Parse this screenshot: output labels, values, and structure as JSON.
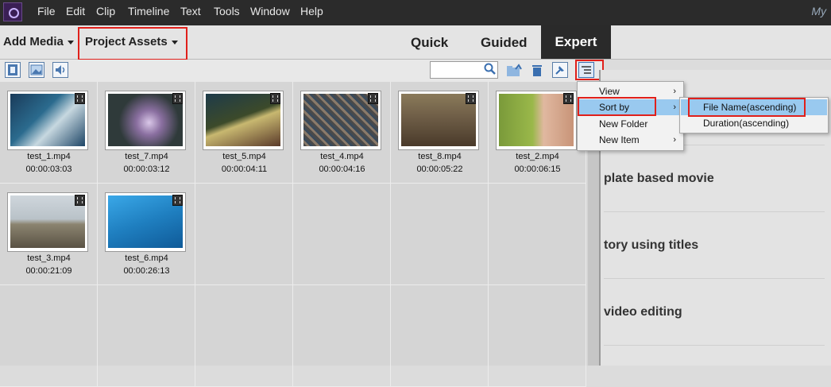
{
  "menu": {
    "items": [
      "File",
      "Edit",
      "Clip",
      "Timeline",
      "Text",
      "Tools",
      "Window",
      "Help"
    ],
    "right_text": "My"
  },
  "modebar": {
    "add_media": "Add Media",
    "project_assets": "Project Assets",
    "tab_quick": "Quick",
    "tab_guided": "Guided",
    "tab_expert": "Expert"
  },
  "toolbar": {
    "view_icons": [
      "film-icon",
      "image-icon",
      "speaker-icon"
    ],
    "search_value": "",
    "right_icons": [
      "search-icon",
      "folder-up-icon",
      "trash-icon",
      "pin-icon",
      "list-menu-icon"
    ]
  },
  "assets": [
    {
      "name": "test_1.mp4",
      "duration": "00:00:03:03",
      "color": "#2b6b8e"
    },
    {
      "name": "test_7.mp4",
      "duration": "00:00:03:12",
      "color": "#6a5a78"
    },
    {
      "name": "test_5.mp4",
      "duration": "00:00:04:11",
      "color": "#3c4a2a"
    },
    {
      "name": "test_4.mp4",
      "duration": "00:00:04:16",
      "color": "#5a5a5a"
    },
    {
      "name": "test_8.mp4",
      "duration": "00:00:05:22",
      "color": "#6b5a44"
    },
    {
      "name": "test_2.mp4",
      "duration": "00:00:06:15",
      "color": "#7a9a3a"
    },
    {
      "name": "test_3.mp4",
      "duration": "00:00:21:09",
      "color": "#8b8470"
    },
    {
      "name": "test_6.mp4",
      "duration": "00:00:26:13",
      "color": "#1f7fc0"
    }
  ],
  "right_panel": {
    "rows": [
      "plate based movie",
      "tory using titles",
      "video editing"
    ]
  },
  "context_menu": {
    "items": [
      {
        "label": "View",
        "has_sub": true
      },
      {
        "label": "Sort by",
        "has_sub": true
      },
      {
        "label": "New Folder",
        "has_sub": false
      },
      {
        "label": "New Item",
        "has_sub": true
      }
    ],
    "sub_items": [
      "File Name(ascending)",
      "Duration(ascending)"
    ]
  }
}
